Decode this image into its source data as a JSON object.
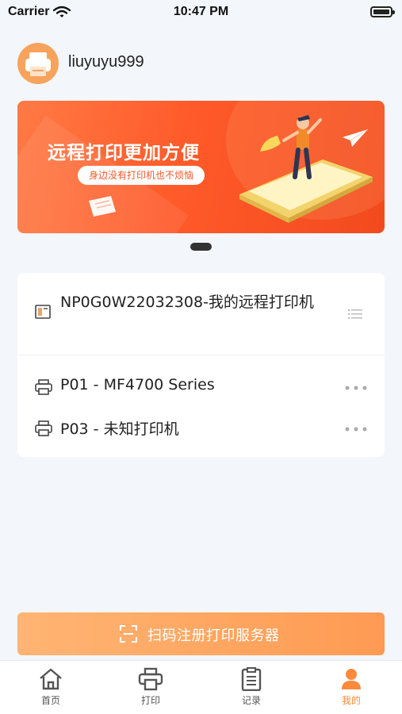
{
  "status_bar": {
    "carrier": "Carrier",
    "time": "10:47 PM"
  },
  "profile": {
    "username": "liuyuyu999",
    "avatar_icon": "printer-avatar-icon"
  },
  "banner": {
    "title": "远程打印更加方便",
    "subtitle": "身边没有打印机也不烦恼",
    "colors": {
      "start": "#ff7a45",
      "end": "#f24a1e"
    }
  },
  "server": {
    "name": "NP0G0W22032308-我的远程打印机",
    "icon": "server-icon",
    "action_icon": "list-icon"
  },
  "printers": [
    {
      "label": "P01 - MF4700 Series",
      "icon": "printer-icon",
      "action_icon": "more-icon"
    },
    {
      "label": "P03 - 未知打印机",
      "icon": "printer-icon",
      "action_icon": "more-icon"
    }
  ],
  "scan_button": {
    "label": "扫码注册打印服务器",
    "icon": "scan-icon"
  },
  "tabbar": {
    "tabs": [
      {
        "label": "首页",
        "icon": "home-icon",
        "active": false
      },
      {
        "label": "打印",
        "icon": "print-icon",
        "active": false
      },
      {
        "label": "记录",
        "icon": "records-icon",
        "active": false
      },
      {
        "label": "我的",
        "icon": "profile-icon",
        "active": true
      }
    ]
  },
  "colors": {
    "accent": "#ff8a3c",
    "background": "#f3f6fa"
  }
}
